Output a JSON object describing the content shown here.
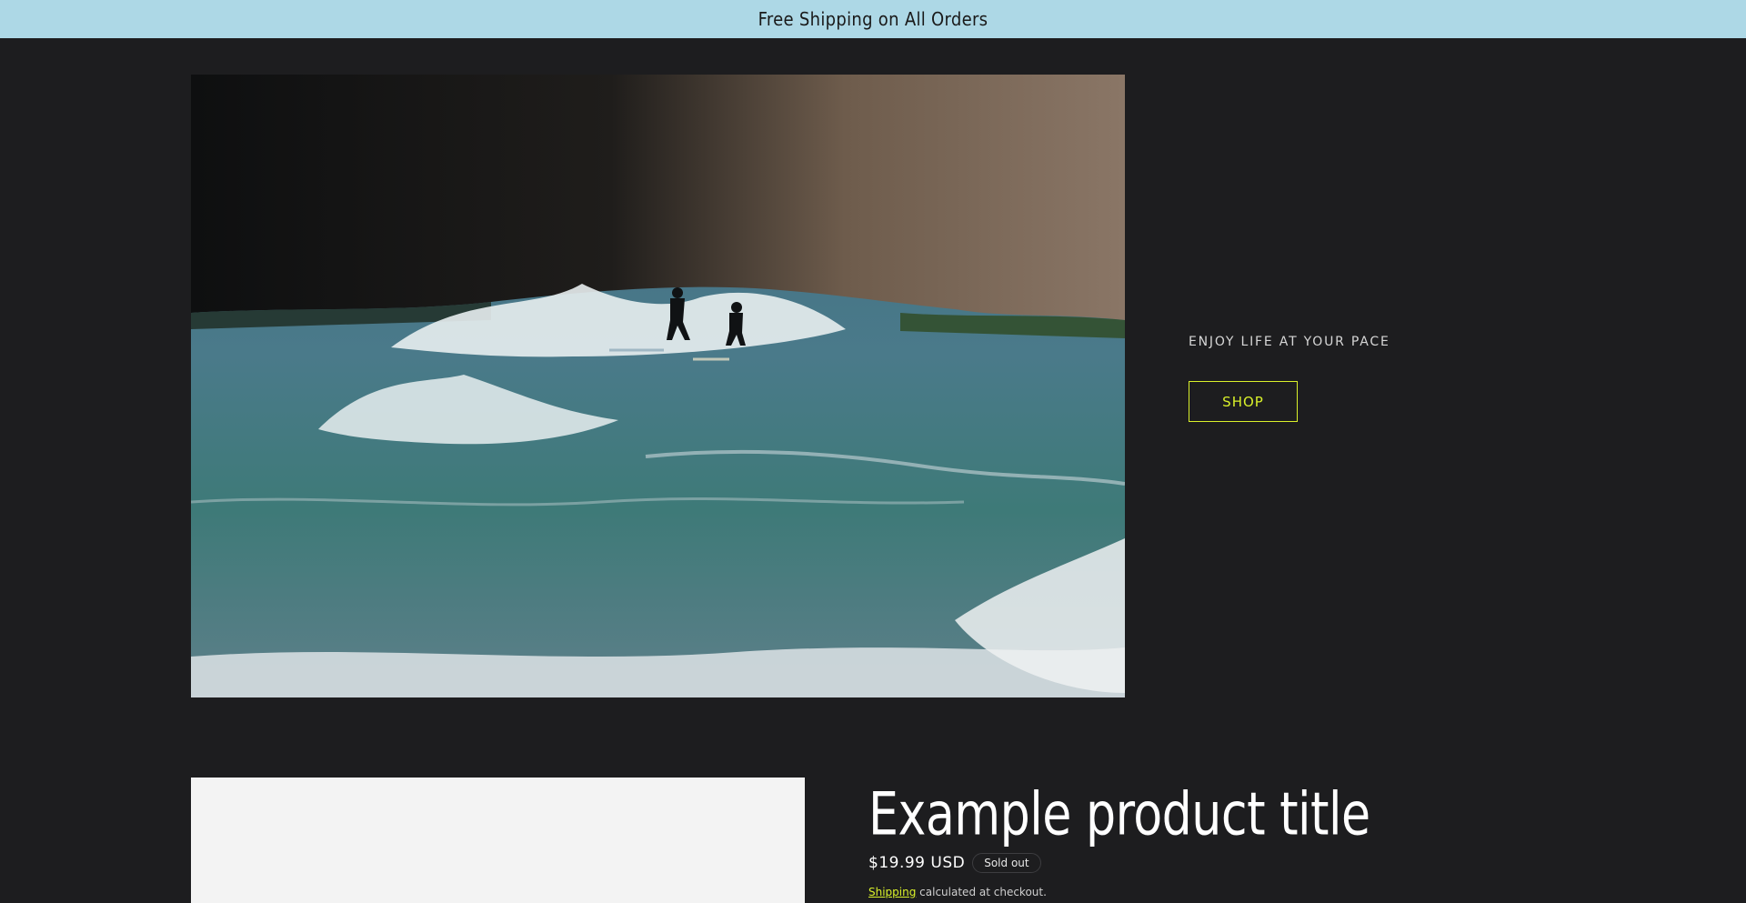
{
  "announcement": {
    "text": "Free Shipping on All Orders"
  },
  "hero": {
    "image_alt": "Two surfers riding a wave beside rocky cliffs",
    "tagline": "ENJOY LIFE AT YOUR PACE",
    "button_label": "SHOP"
  },
  "product": {
    "title": "Example product title",
    "price": "$19.99 USD",
    "badge": "Sold out",
    "shipping_link": "Shipping",
    "shipping_suffix": " calculated at checkout."
  },
  "colors": {
    "background": "#1d1d1f",
    "announcement_bar": "#add8e6",
    "accent": "#d9f02a"
  }
}
